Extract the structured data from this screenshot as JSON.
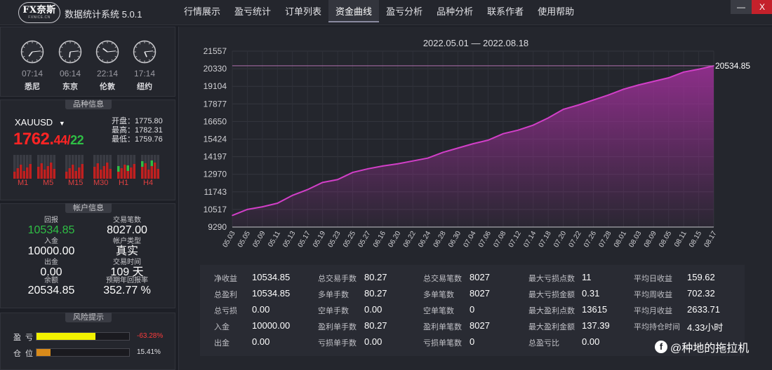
{
  "app": {
    "logo_main": "FX奈斯",
    "logo_sub": "FXNICE.CN",
    "title": "数据统计系统 5.0.1",
    "minimize": "—",
    "close": "X"
  },
  "nav": [
    {
      "label": "行情展示"
    },
    {
      "label": "盈亏统计"
    },
    {
      "label": "订单列表"
    },
    {
      "label": "资金曲线"
    },
    {
      "label": "盈亏分析"
    },
    {
      "label": "品种分析"
    },
    {
      "label": "联系作者"
    },
    {
      "label": "使用帮助"
    }
  ],
  "active_nav": "资金曲线",
  "clocks": [
    {
      "time": "07:14",
      "city": "悉尼",
      "h": 7,
      "m": 14
    },
    {
      "time": "06:14",
      "city": "东京",
      "h": 6,
      "m": 14
    },
    {
      "time": "22:14",
      "city": "伦敦",
      "h": 22,
      "m": 14
    },
    {
      "time": "17:14",
      "city": "纽约",
      "h": 17,
      "m": 14
    }
  ],
  "quote": {
    "header": "品种信息",
    "symbol": "XAUUSD",
    "price_main": "1762.",
    "price_frac": "44",
    "price_sep": "/",
    "price_green": "22",
    "open": "开盘：1775.80",
    "high": "最高：1782.31",
    "low": "最低：1759.76",
    "timeframes": [
      "M1",
      "M5",
      "M15",
      "M30",
      "H1",
      "H4"
    ]
  },
  "account": {
    "header": "帐户信息",
    "items": [
      {
        "label": "回报",
        "value": "10534.85",
        "green": true
      },
      {
        "label": "交易笔数",
        "value": "8027.00"
      },
      {
        "label": "入金",
        "value": "10000.00"
      },
      {
        "label": "帐户类型",
        "value": "真实"
      },
      {
        "label": "出金",
        "value": "0.00"
      },
      {
        "label": "交易时间",
        "value": "109 天"
      },
      {
        "label": "余额",
        "value": "20534.85"
      },
      {
        "label": "预期年回报率",
        "value": "352.77 %"
      }
    ]
  },
  "risk": {
    "header": "风险提示",
    "rows": [
      {
        "label": "盈亏",
        "pct": "-63.28%",
        "level": 0.6328,
        "color": "#f2f200",
        "pct_color": "#ff3b3b"
      },
      {
        "label": "仓位",
        "pct": "15.41%",
        "level": 0.1541,
        "color": "#d88a1a",
        "pct_color": "#e0e0e4"
      }
    ]
  },
  "chart_data": {
    "type": "area",
    "title": "2022.05.01 — 2022.08.18",
    "y_ticks": [
      "21557",
      "20330",
      "19104",
      "17877",
      "16650",
      "15424",
      "14197",
      "12970",
      "11743",
      "10517",
      "9290"
    ],
    "ylim": [
      9290,
      21557
    ],
    "x_labels": [
      "05.03",
      "05.05",
      "05.09",
      "05.11",
      "05.13",
      "05.17",
      "05.19",
      "05.23",
      "05.25",
      "05.27",
      "06.16",
      "06.20",
      "06.22",
      "06.24",
      "06.28",
      "06.30",
      "07.04",
      "07.06",
      "07.08",
      "07.12",
      "07.14",
      "07.18",
      "07.20",
      "07.22",
      "07.26",
      "07.28",
      "08.01",
      "08.03",
      "08.09",
      "08.05",
      "08.11",
      "08.15",
      "08.17"
    ],
    "end_label": "20534.85",
    "ref_value": 20534.85,
    "values": [
      10100,
      10520,
      10700,
      10950,
      11500,
      11900,
      12400,
      12600,
      13100,
      13350,
      13550,
      13700,
      13900,
      14100,
      14500,
      14800,
      15100,
      15350,
      15800,
      16050,
      16400,
      16900,
      17500,
      17800,
      18150,
      18500,
      18900,
      19200,
      19450,
      19700,
      20100,
      20300,
      20534.85
    ],
    "color": "#a0309a"
  },
  "stats": {
    "columns": [
      [
        {
          "label": "净收益",
          "value": "10534.85"
        },
        {
          "label": "总盈利",
          "value": "10534.85"
        },
        {
          "label": "总亏损",
          "value": "0.00"
        },
        {
          "label": "入金",
          "value": "10000.00"
        },
        {
          "label": "出金",
          "value": "0.00"
        }
      ],
      [
        {
          "label": "总交易手数",
          "value": "80.27"
        },
        {
          "label": "多单手数",
          "value": "80.27"
        },
        {
          "label": "空单手数",
          "value": "0.00"
        },
        {
          "label": "盈利单手数",
          "value": "80.27"
        },
        {
          "label": "亏损单手数",
          "value": "0.00"
        }
      ],
      [
        {
          "label": "总交易笔数",
          "value": "8027"
        },
        {
          "label": "多单笔数",
          "value": "8027"
        },
        {
          "label": "空单笔数",
          "value": "0"
        },
        {
          "label": "盈利单笔数",
          "value": "8027"
        },
        {
          "label": "亏损单笔数",
          "value": "0"
        }
      ],
      [
        {
          "label": "最大亏损点数",
          "value": "11"
        },
        {
          "label": "最大亏损金额",
          "value": "0.31"
        },
        {
          "label": "最大盈利点数",
          "value": "13615"
        },
        {
          "label": "最大盈利金额",
          "value": "137.39"
        },
        {
          "label": "总盈亏比",
          "value": "0.00"
        }
      ],
      [
        {
          "label": "平均日收益",
          "value": "159.62"
        },
        {
          "label": "平均周收益",
          "value": "702.32"
        },
        {
          "label": "平均月收益",
          "value": "2633.71"
        },
        {
          "label": "平均持仓时间",
          "value": "4.33小时"
        }
      ]
    ]
  },
  "watermark": {
    "icon_glyph": "f",
    "text": "@种地的拖拉机"
  }
}
